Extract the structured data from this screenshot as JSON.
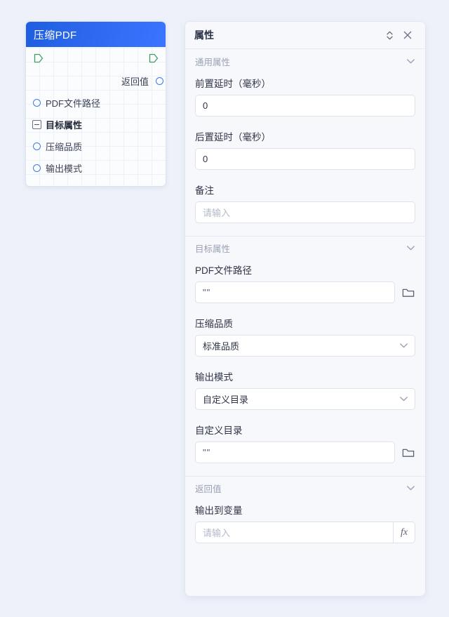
{
  "canvas": {
    "node": {
      "title": "压缩PDF",
      "return_label": "返回值",
      "items": [
        {
          "label": "PDF文件路径",
          "type": "port"
        },
        {
          "label": "目标属性",
          "type": "group"
        },
        {
          "label": "压缩品质",
          "type": "port"
        },
        {
          "label": "输出模式",
          "type": "port"
        }
      ],
      "header_color": "#2f6bf2",
      "flow_port_color": "#3f9e62",
      "data_port_color": "#3f7ae8"
    }
  },
  "panel": {
    "title": "属性",
    "header_icons": [
      {
        "name": "expand-collapse-icon"
      },
      {
        "name": "close-icon"
      }
    ],
    "sections": [
      {
        "title": "通用属性",
        "fields": [
          {
            "label": "前置延时（毫秒）",
            "kind": "text",
            "value": "0",
            "placeholder": ""
          },
          {
            "label": "后置延时（毫秒）",
            "kind": "text",
            "value": "0",
            "placeholder": ""
          },
          {
            "label": "备注",
            "kind": "text",
            "value": "",
            "placeholder": "请输入"
          }
        ]
      },
      {
        "title": "目标属性",
        "fields": [
          {
            "label": "PDF文件路径",
            "kind": "file",
            "value": "\"\"",
            "placeholder": ""
          },
          {
            "label": "压缩品质",
            "kind": "select",
            "value": "标准品质"
          },
          {
            "label": "输出模式",
            "kind": "select",
            "value": "自定义目录"
          },
          {
            "label": "自定义目录",
            "kind": "file",
            "value": "\"\"",
            "placeholder": ""
          }
        ]
      },
      {
        "title": "返回值",
        "fields": [
          {
            "label": "输出到变量",
            "kind": "fx",
            "value": "",
            "placeholder": "请输入",
            "fx_label": "fx"
          }
        ]
      }
    ]
  }
}
